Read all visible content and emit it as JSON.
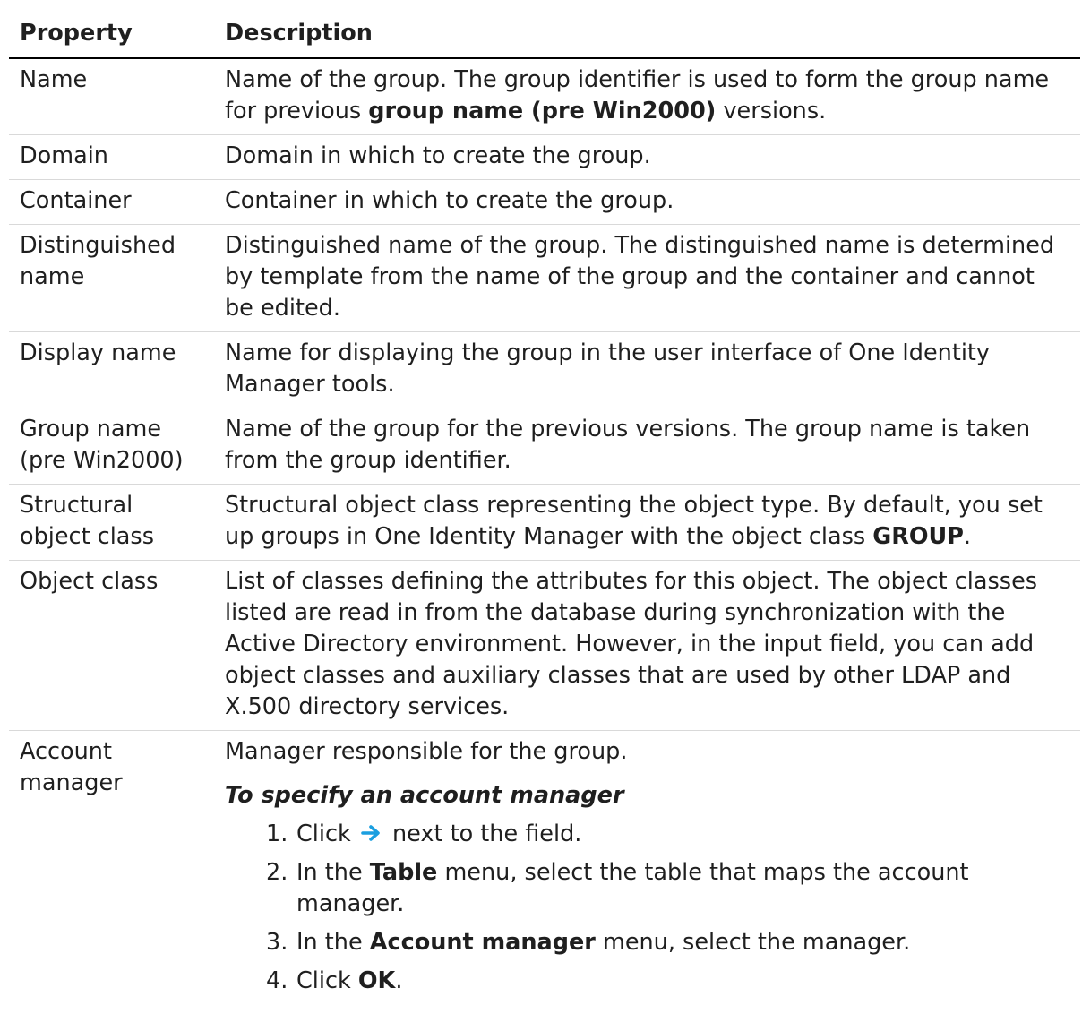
{
  "header": {
    "property": "Property",
    "description": "Description"
  },
  "rows": [
    {
      "property": "Name",
      "desc_a": "Name of the group. The group identifier is used to form the group name for previous ",
      "desc_bold": "group name (pre Win2000)",
      "desc_b": " versions."
    },
    {
      "property": "Domain",
      "description": "Domain in which to create the group."
    },
    {
      "property": "Container",
      "description": "Container in which to create the group."
    },
    {
      "property": "Distinguished name",
      "description": "Distinguished name of the group. The distinguished name is determined by template from the name of the group and the container and cannot be edited."
    },
    {
      "property": "Display name",
      "description": "Name for displaying the group in the user interface of One Identity Manager tools."
    },
    {
      "property": "Group name (pre Win2000)",
      "description": "Name of the group for the previous versions. The group name is taken from the group identifier."
    },
    {
      "property": "Structural object class",
      "desc_a": "Structural object class representing the object type. By default, you set up groups in One Identity Manager with the object class ",
      "desc_bold": "GROUP",
      "desc_b": "."
    },
    {
      "property": "Object class",
      "description": "List of classes defining the attributes for this object. The object classes listed are read in from the database during synchronization with the Active Directory environment. However, in the input field, you can add object classes and auxiliary classes that are used by other LDAP and X.500 directory services."
    },
    {
      "property": "Account manager",
      "description": "Manager responsible for the group.",
      "procedure_title": "To specify an account manager",
      "steps": [
        {
          "num": "1.",
          "a": "Click ",
          "icon": "arrow-right-icon",
          "b": " next to the field."
        },
        {
          "num": "2.",
          "a": "In the ",
          "bold": "Table",
          "b": " menu, select the table that maps the account manager."
        },
        {
          "num": "3.",
          "a": "In the ",
          "bold": "Account manager",
          "b": " menu, select the manager."
        },
        {
          "num": "4.",
          "a": "Click ",
          "bold": "OK",
          "b": "."
        }
      ]
    }
  ],
  "colors": {
    "arrow": "#1a9fe0",
    "divider": "#d9d9d9",
    "header_rule": "#000000"
  }
}
